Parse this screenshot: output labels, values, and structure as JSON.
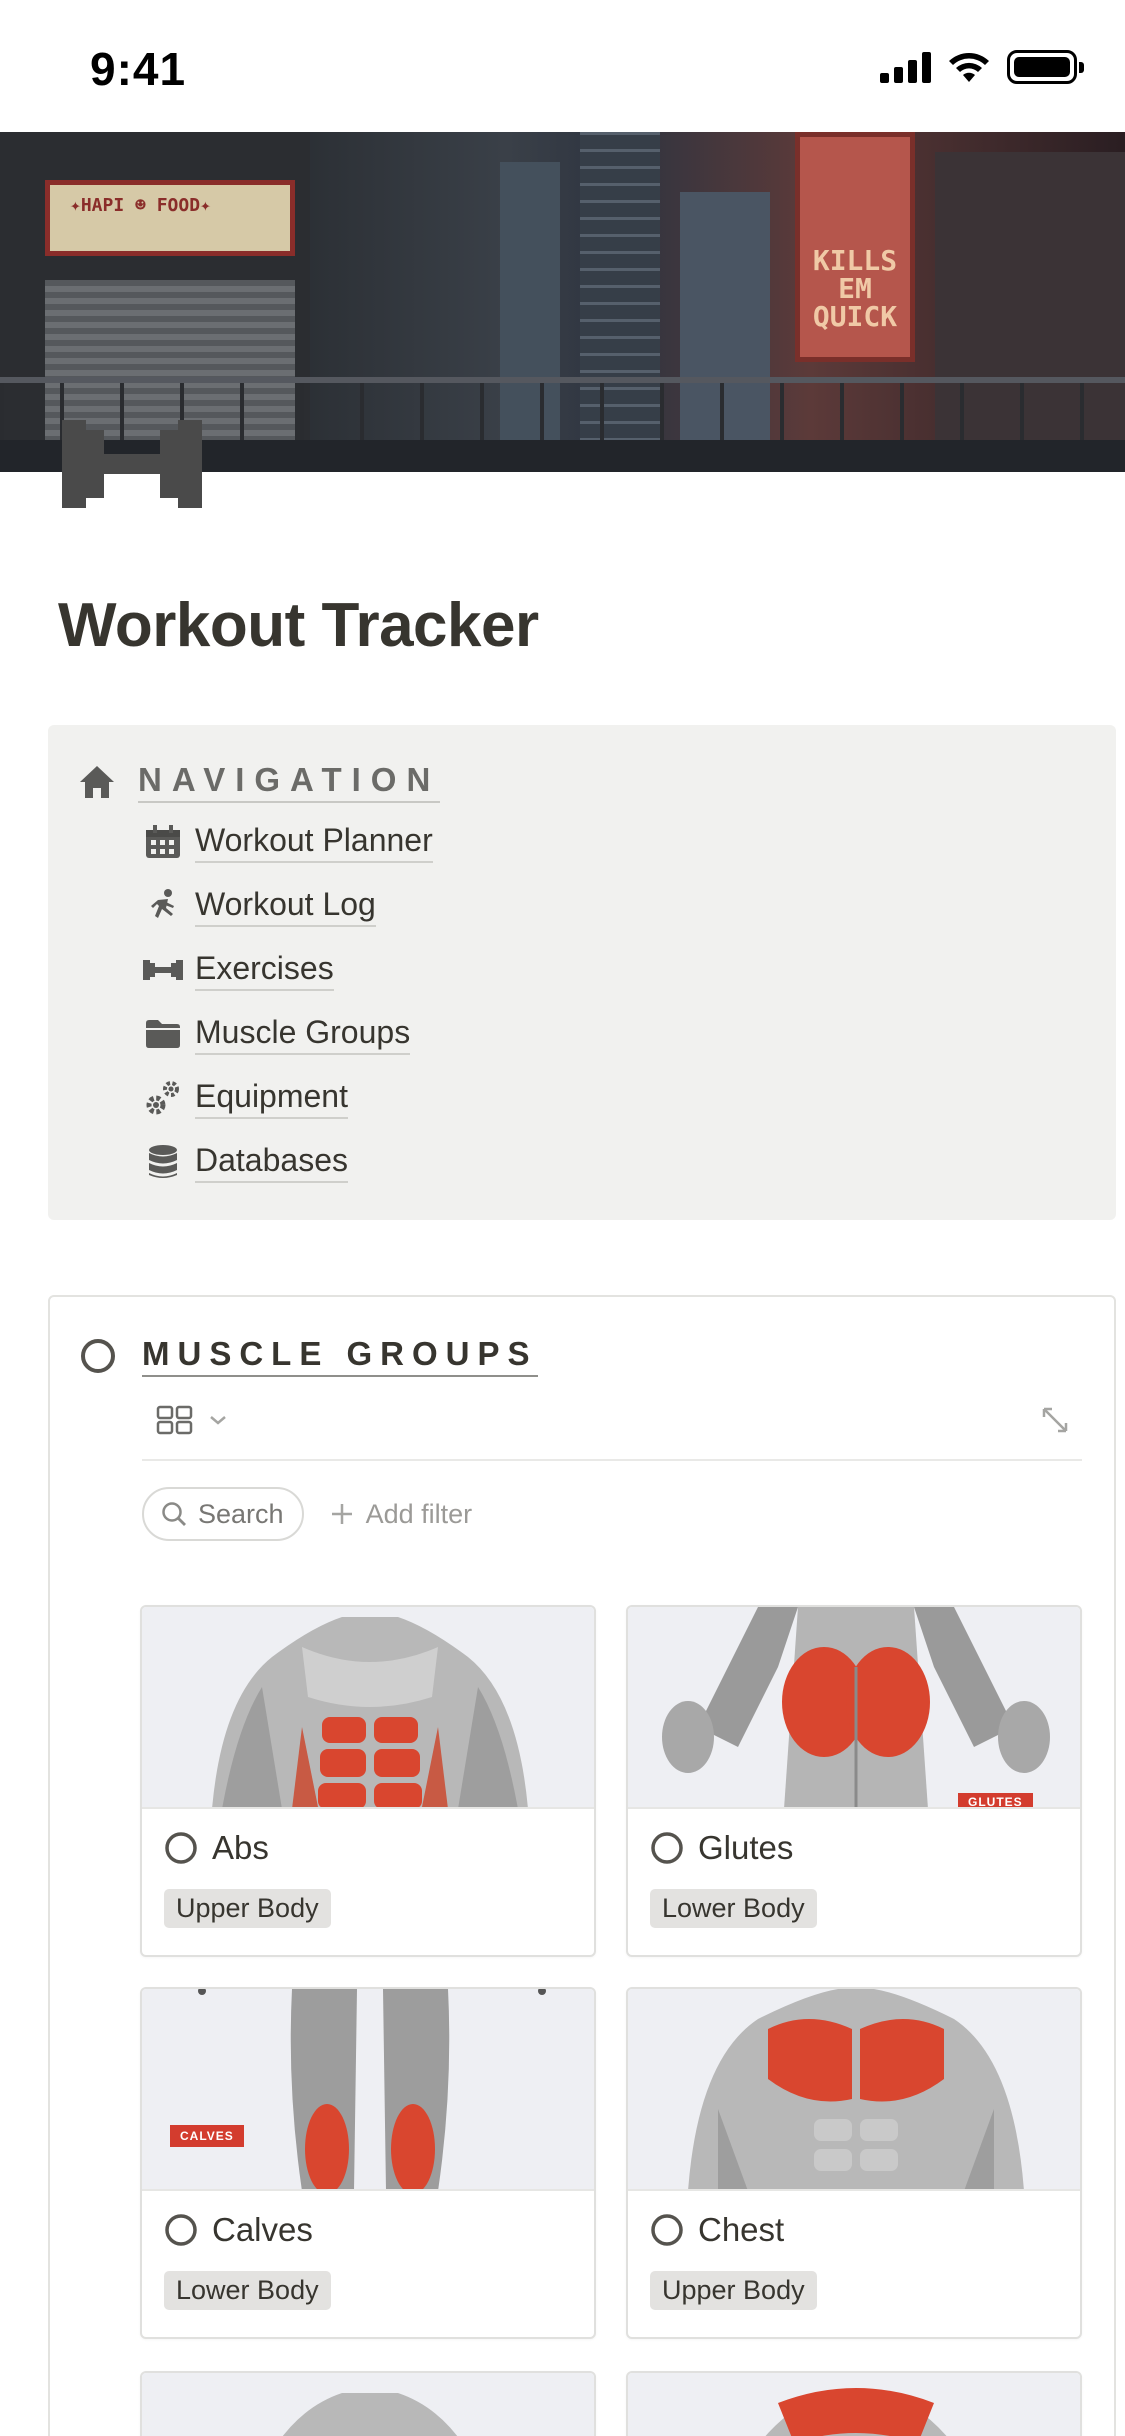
{
  "status_bar": {
    "time": "9:41"
  },
  "page": {
    "title": "Workout Tracker"
  },
  "navigation": {
    "heading": "NAVIGATION",
    "items": [
      {
        "label": "Workout Planner",
        "icon": "calendar-icon"
      },
      {
        "label": "Workout Log",
        "icon": "running-icon"
      },
      {
        "label": "Exercises",
        "icon": "dumbbell-icon"
      },
      {
        "label": "Muscle Groups",
        "icon": "folder-icon"
      },
      {
        "label": "Equipment",
        "icon": "gears-icon"
      },
      {
        "label": "Databases",
        "icon": "database-icon"
      }
    ]
  },
  "muscle_groups": {
    "heading": "MUSCLE GROUPS",
    "search_label": "Search",
    "add_filter_label": "Add filter",
    "cards": [
      {
        "name": "Abs",
        "tag": "Upper Body"
      },
      {
        "name": "Glutes",
        "tag": "Lower Body",
        "image_label": "GLUTES"
      },
      {
        "name": "Calves",
        "tag": "Lower Body",
        "image_label": "CALVES"
      },
      {
        "name": "Chest",
        "tag": "Upper Body"
      }
    ]
  },
  "colors": {
    "text": "#37352f",
    "callout_bg": "#f1f1ef",
    "tag_bg": "#e3e2e0",
    "muscle_red": "#d9462f"
  }
}
